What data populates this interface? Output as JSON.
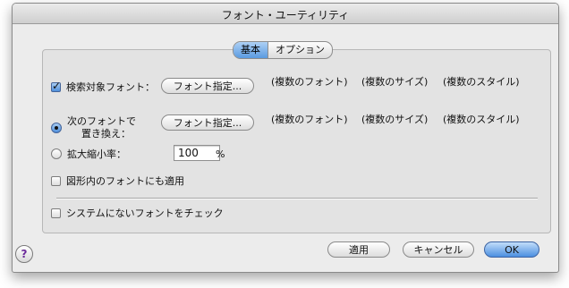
{
  "window": {
    "title": "フォント・ユーティリティ"
  },
  "tabs": [
    {
      "label": "基本",
      "selected": true
    },
    {
      "label": "オプション",
      "selected": false
    }
  ],
  "options": {
    "search_font": {
      "label": "検索対象フォント：",
      "checked": true,
      "button_label": "フォント指定...",
      "font": "(複数のフォント)",
      "size": "(複数のサイズ)",
      "style": "(複数のスタイル)"
    },
    "replace_font": {
      "label_line1": "次のフォントで",
      "label_line2": "置き換え：",
      "selected": true,
      "button_label": "フォント指定...",
      "font": "(複数のフォント)",
      "size": "(複数のサイズ)",
      "style": "(複数のスタイル)"
    },
    "scale": {
      "label": "拡大縮小率：",
      "selected": false,
      "value": "100",
      "unit": "%"
    },
    "apply_in_shapes": {
      "label": "図形内のフォントにも適用",
      "checked": false
    },
    "check_missing": {
      "label": "システムにないフォントをチェック",
      "checked": false
    }
  },
  "buttons": {
    "apply": "適用",
    "cancel": "キャンセル",
    "ok": "OK",
    "help": "?"
  },
  "colors": {
    "accent": "#5a9ae0",
    "help_glyph": "#6b2a9a"
  }
}
